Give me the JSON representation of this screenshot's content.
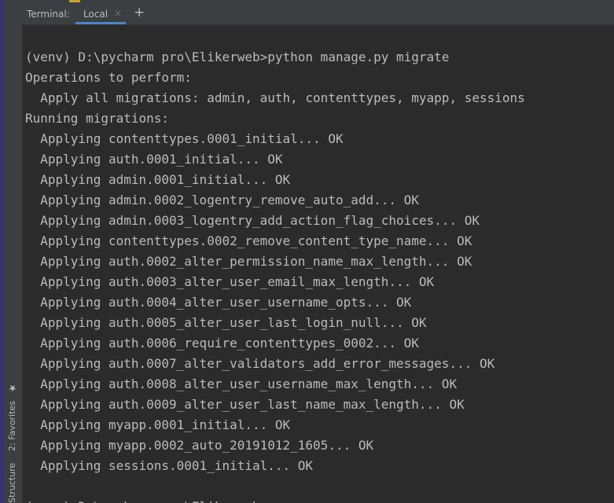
{
  "sidebar": {
    "favorites_label": "2: Favorites",
    "favorites_icon": "star-icon",
    "structure_label": "Structure"
  },
  "toolwindow": {
    "title": "Terminal:",
    "tab_label": "Local",
    "close_symbol": "×",
    "add_symbol": "+"
  },
  "terminal": {
    "lines": [
      "",
      "(venv) D:\\pycharm pro\\Elikerweb>python manage.py migrate",
      "Operations to perform:",
      "  Apply all migrations: admin, auth, contenttypes, myapp, sessions",
      "Running migrations:",
      "  Applying contenttypes.0001_initial... OK",
      "  Applying auth.0001_initial... OK",
      "  Applying admin.0001_initial... OK",
      "  Applying admin.0002_logentry_remove_auto_add... OK",
      "  Applying admin.0003_logentry_add_action_flag_choices... OK",
      "  Applying contenttypes.0002_remove_content_type_name... OK",
      "  Applying auth.0002_alter_permission_name_max_length... OK",
      "  Applying auth.0003_alter_user_email_max_length... OK",
      "  Applying auth.0004_alter_user_username_opts... OK",
      "  Applying auth.0005_alter_user_last_login_null... OK",
      "  Applying auth.0006_require_contenttypes_0002... OK",
      "  Applying auth.0007_alter_validators_add_error_messages... OK",
      "  Applying auth.0008_alter_user_username_max_length... OK",
      "  Applying auth.0009_alter_user_last_name_max_length... OK",
      "  Applying myapp.0001_initial... OK",
      "  Applying myapp.0002_auto_20191012_1605... OK",
      "  Applying sessions.0001_initial... OK",
      "",
      "(venv) D:\\pycharm pro\\Elikerweb>"
    ]
  },
  "colors": {
    "terminal_bg": "#2b2b2b",
    "terminal_fg": "#bbbbbb",
    "chrome_bg": "#3c3f41",
    "tab_accent": "#4a88c7"
  }
}
